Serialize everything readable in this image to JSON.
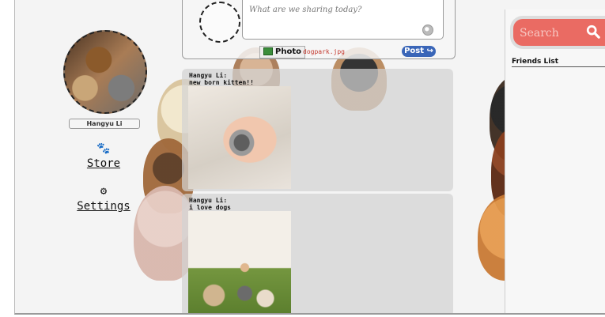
{
  "profile": {
    "name": "Hangyu Li"
  },
  "nav": {
    "store": {
      "label": "Store",
      "icon": "paw-icon"
    },
    "settings": {
      "label": "Settings",
      "icon": "gear-icon"
    }
  },
  "composer": {
    "placeholder": "What are we sharing today?",
    "photo_label": "Photo",
    "filename": "dogpark.jpg",
    "post_label": "Post"
  },
  "feed": {
    "posts": [
      {
        "author": "Hangyu Li:",
        "text": "new born kitten!!"
      },
      {
        "author": "Hangyu Li:",
        "text": "i love dogs"
      }
    ]
  },
  "sidebar": {
    "search_placeholder": "Search",
    "friends_title": "Friends List"
  },
  "colors": {
    "search_bg": "#ea6b63",
    "post_button": "#3a66b8",
    "filename": "#c3362b"
  }
}
